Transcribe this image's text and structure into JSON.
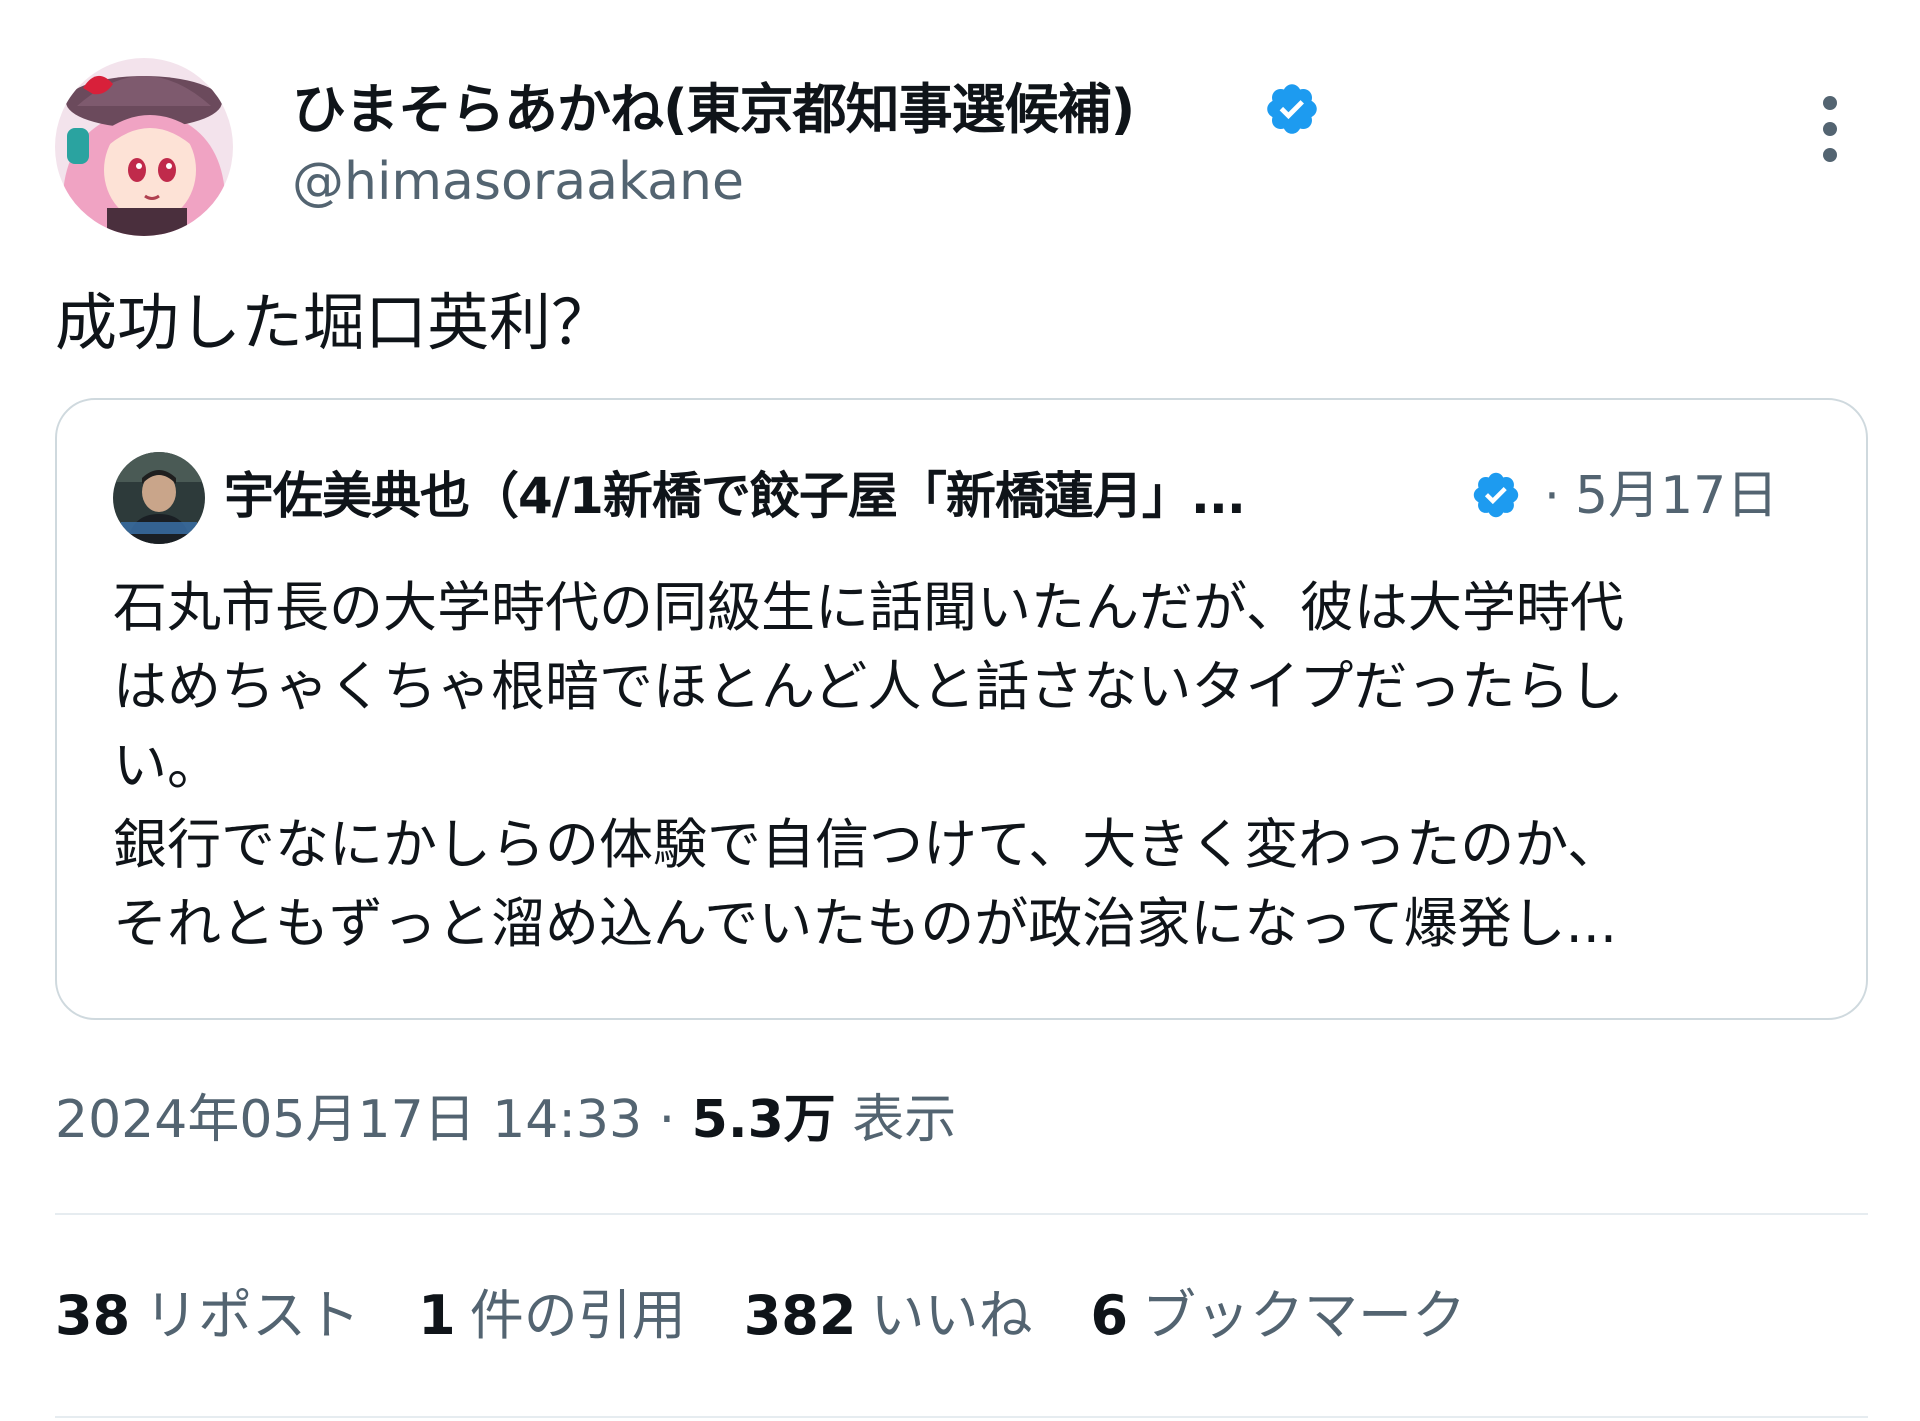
{
  "author": {
    "name": "ひまそらあかね(東京都知事選候補)",
    "handle": "@himasoraakane",
    "avatar_icon": "anime-girl-avatar-icon",
    "verified_icon": "verified-badge-icon"
  },
  "tweet": {
    "text": "成功した堀口英利？",
    "timestamp": "2024年05月17日 14:33",
    "separator": " · ",
    "views_count": "5.3万",
    "views_label": " 表示"
  },
  "quote": {
    "author_name": "宇佐美典也（4/1新橋で餃子屋「新橋蓮月」...",
    "separator": "·",
    "date": "5月17日",
    "lines": [
      "石丸市長の大学時代の同級生に話聞いたんだが、彼は大学時代",
      "はめちゃくちゃ根暗でほとんど人と話さないタイプだったらし",
      "い。",
      "銀行でなにかしらの体験で自信つけて、大きく変わったのか、",
      "それともずっと溜め込んでいたものが政治家になって爆発し..."
    ]
  },
  "stats": {
    "reposts_count": "38",
    "reposts_label": "リポスト",
    "quotes_count": "1",
    "quotes_label": "件の引用",
    "likes_count": "382",
    "likes_label": "いいね",
    "bookmarks_count": "6",
    "bookmarks_label": "ブックマーク"
  },
  "colors": {
    "verified": "#1d9bf0",
    "secondary_text": "#536471",
    "primary_text": "#0f1419",
    "border": "#cfd9de"
  }
}
